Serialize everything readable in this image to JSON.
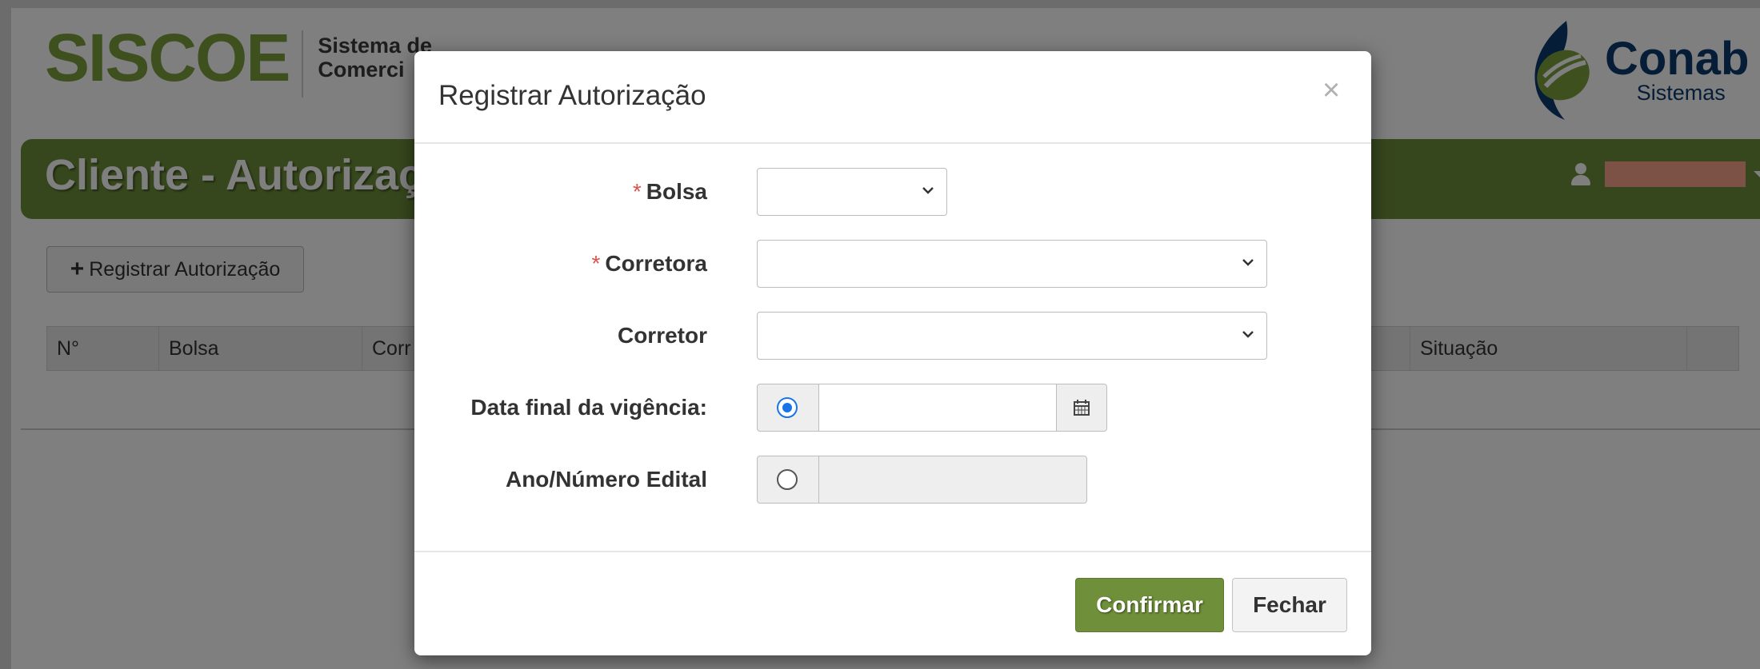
{
  "header": {
    "logo_text": "SISCOE",
    "logo_subtitle_line1": "Sistema de",
    "logo_subtitle_line2": "Comerci",
    "brand_name": "Conab",
    "brand_sub": "Sistemas"
  },
  "titlebar": {
    "title": "Cliente - Autorizaç",
    "user_icon": "user-icon",
    "user_name": ""
  },
  "toolbar": {
    "register_button_label": "Registrar Autorização",
    "plus_icon": "+"
  },
  "table": {
    "columns": [
      "N°",
      "Bolsa",
      "Corr",
      "Situação"
    ]
  },
  "modal": {
    "title": "Registrar Autorização",
    "close_glyph": "×",
    "fields": {
      "bolsa": {
        "required_mark": "*",
        "label": "Bolsa",
        "value": ""
      },
      "corretora": {
        "required_mark": "*",
        "label": "Corretora",
        "value": ""
      },
      "corretor": {
        "label": "Corretor",
        "value": ""
      },
      "data_final": {
        "label": "Data final da vigência:",
        "value": "",
        "radio_selected": true
      },
      "ano_numero": {
        "label": "Ano/Número Edital",
        "value": "",
        "radio_selected": false
      }
    },
    "buttons": {
      "confirm": "Confirmar",
      "close": "Fechar"
    }
  },
  "colors": {
    "brand_green": "#6f8f3a",
    "logo_green": "#7fa03e",
    "conab_blue": "#0d3b6e",
    "required_red": "#d9534f",
    "radio_blue": "#1a73e8",
    "redacted": "#f9a58e"
  }
}
